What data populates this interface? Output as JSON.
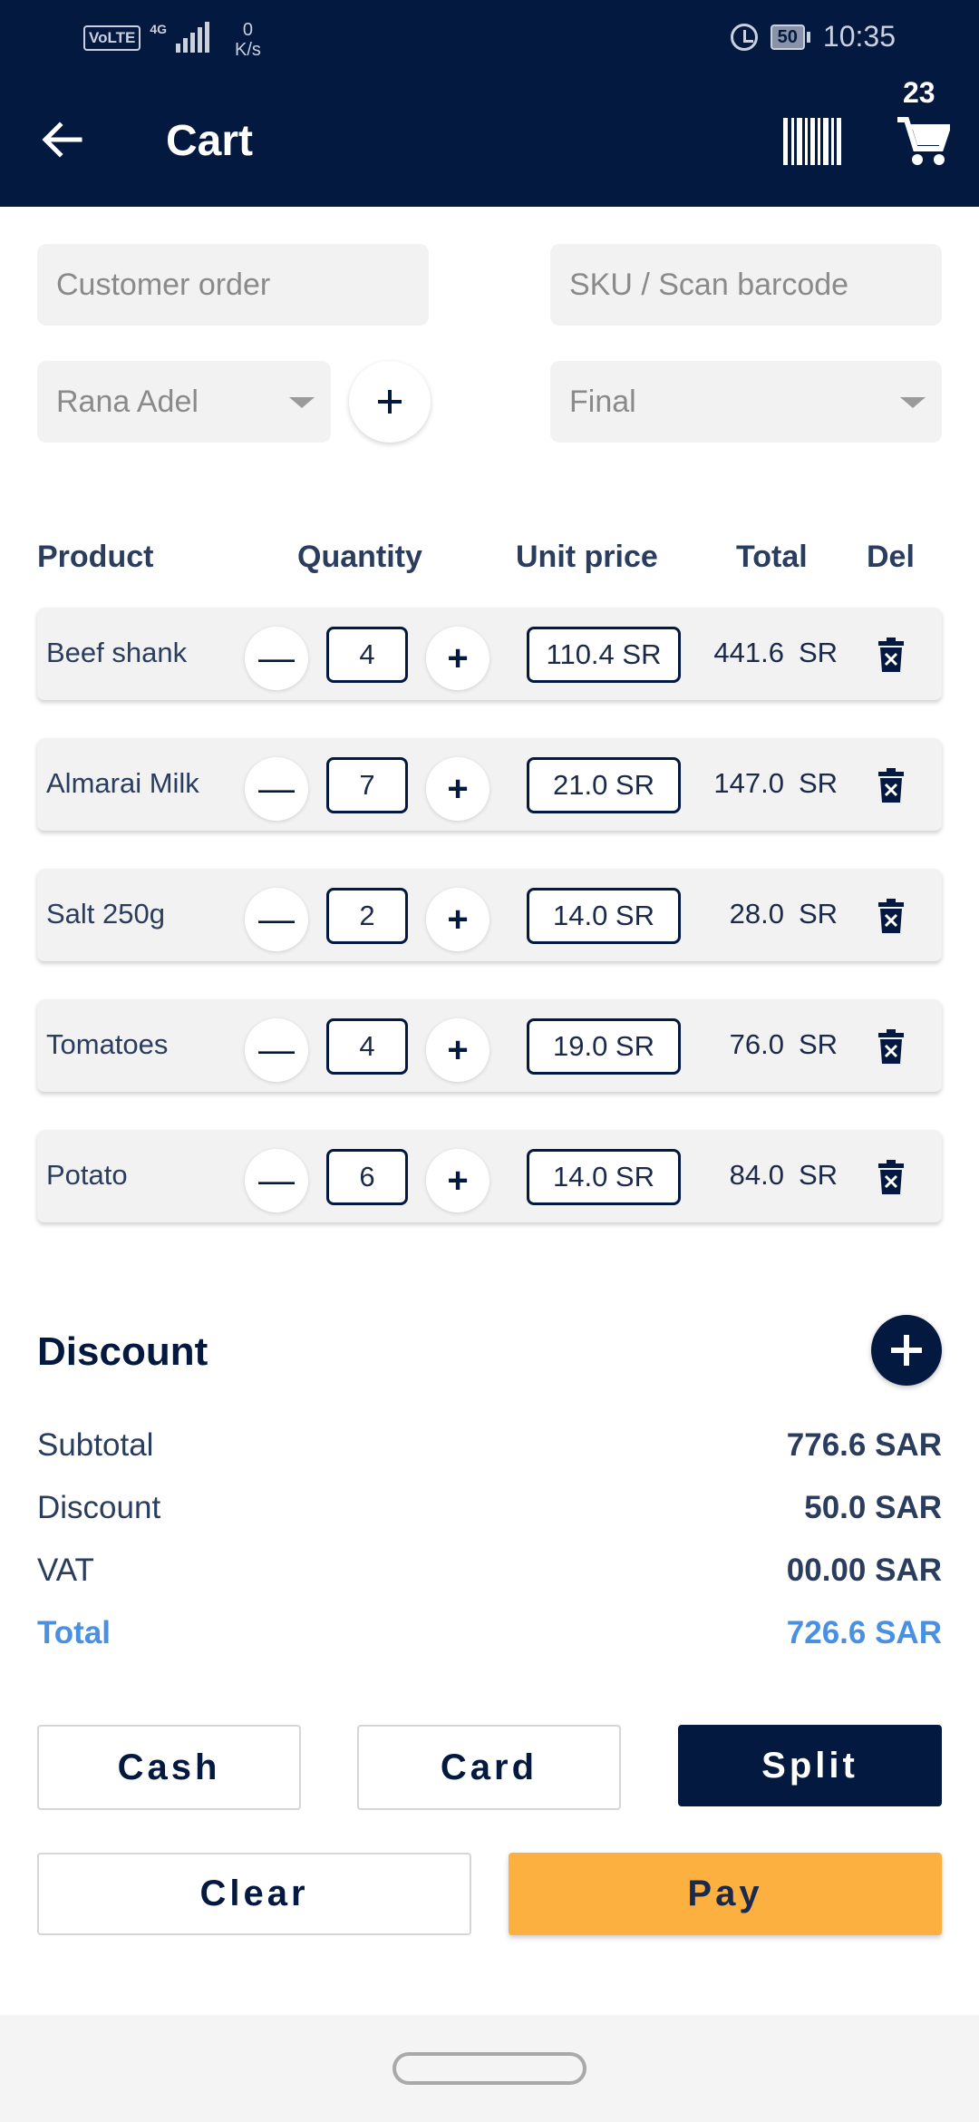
{
  "status_bar": {
    "volte": "VoLTE",
    "network": "4G",
    "speed_value": "0",
    "speed_unit": "K/s",
    "battery": "50",
    "time": "10:35"
  },
  "header": {
    "title": "Cart",
    "cart_count": "23"
  },
  "inputs": {
    "customer_order_placeholder": "Customer order",
    "sku_placeholder": "SKU / Scan barcode",
    "customer_select": "Rana Adel",
    "price_type_select": "Final"
  },
  "table": {
    "headers": {
      "product": "Product",
      "quantity": "Quantity",
      "unit_price": "Unit price",
      "total": "Total",
      "del": "Del"
    },
    "rows": [
      {
        "name": "Beef shank",
        "qty": "4",
        "unit_price": "110.4 SR",
        "total": "441.6",
        "currency": "SR"
      },
      {
        "name": "Almarai Milk",
        "qty": "7",
        "unit_price": "21.0 SR",
        "total": "147.0",
        "currency": "SR"
      },
      {
        "name": "Salt 250g",
        "qty": "2",
        "unit_price": "14.0 SR",
        "total": "28.0",
        "currency": "SR"
      },
      {
        "name": "Tomatoes",
        "qty": "4",
        "unit_price": "19.0 SR",
        "total": "76.0",
        "currency": "SR"
      },
      {
        "name": "Potato",
        "qty": "6",
        "unit_price": "14.0 SR",
        "total": "84.0",
        "currency": "SR"
      }
    ]
  },
  "discount": {
    "title": "Discount"
  },
  "summary": {
    "subtotal_label": "Subtotal",
    "subtotal_value": "776.6 SAR",
    "discount_label": "Discount",
    "discount_value": "50.0 SAR",
    "vat_label": "VAT",
    "vat_value": "00.00 SAR",
    "total_label": "Total",
    "total_value": "726.6 SAR"
  },
  "buttons": {
    "cash": "Cash",
    "card": "Card",
    "split": "Split",
    "clear": "Clear",
    "pay": "Pay"
  },
  "colors": {
    "primary": "#04193f",
    "accent_total": "#4a90e2",
    "pay": "#fbb040"
  }
}
